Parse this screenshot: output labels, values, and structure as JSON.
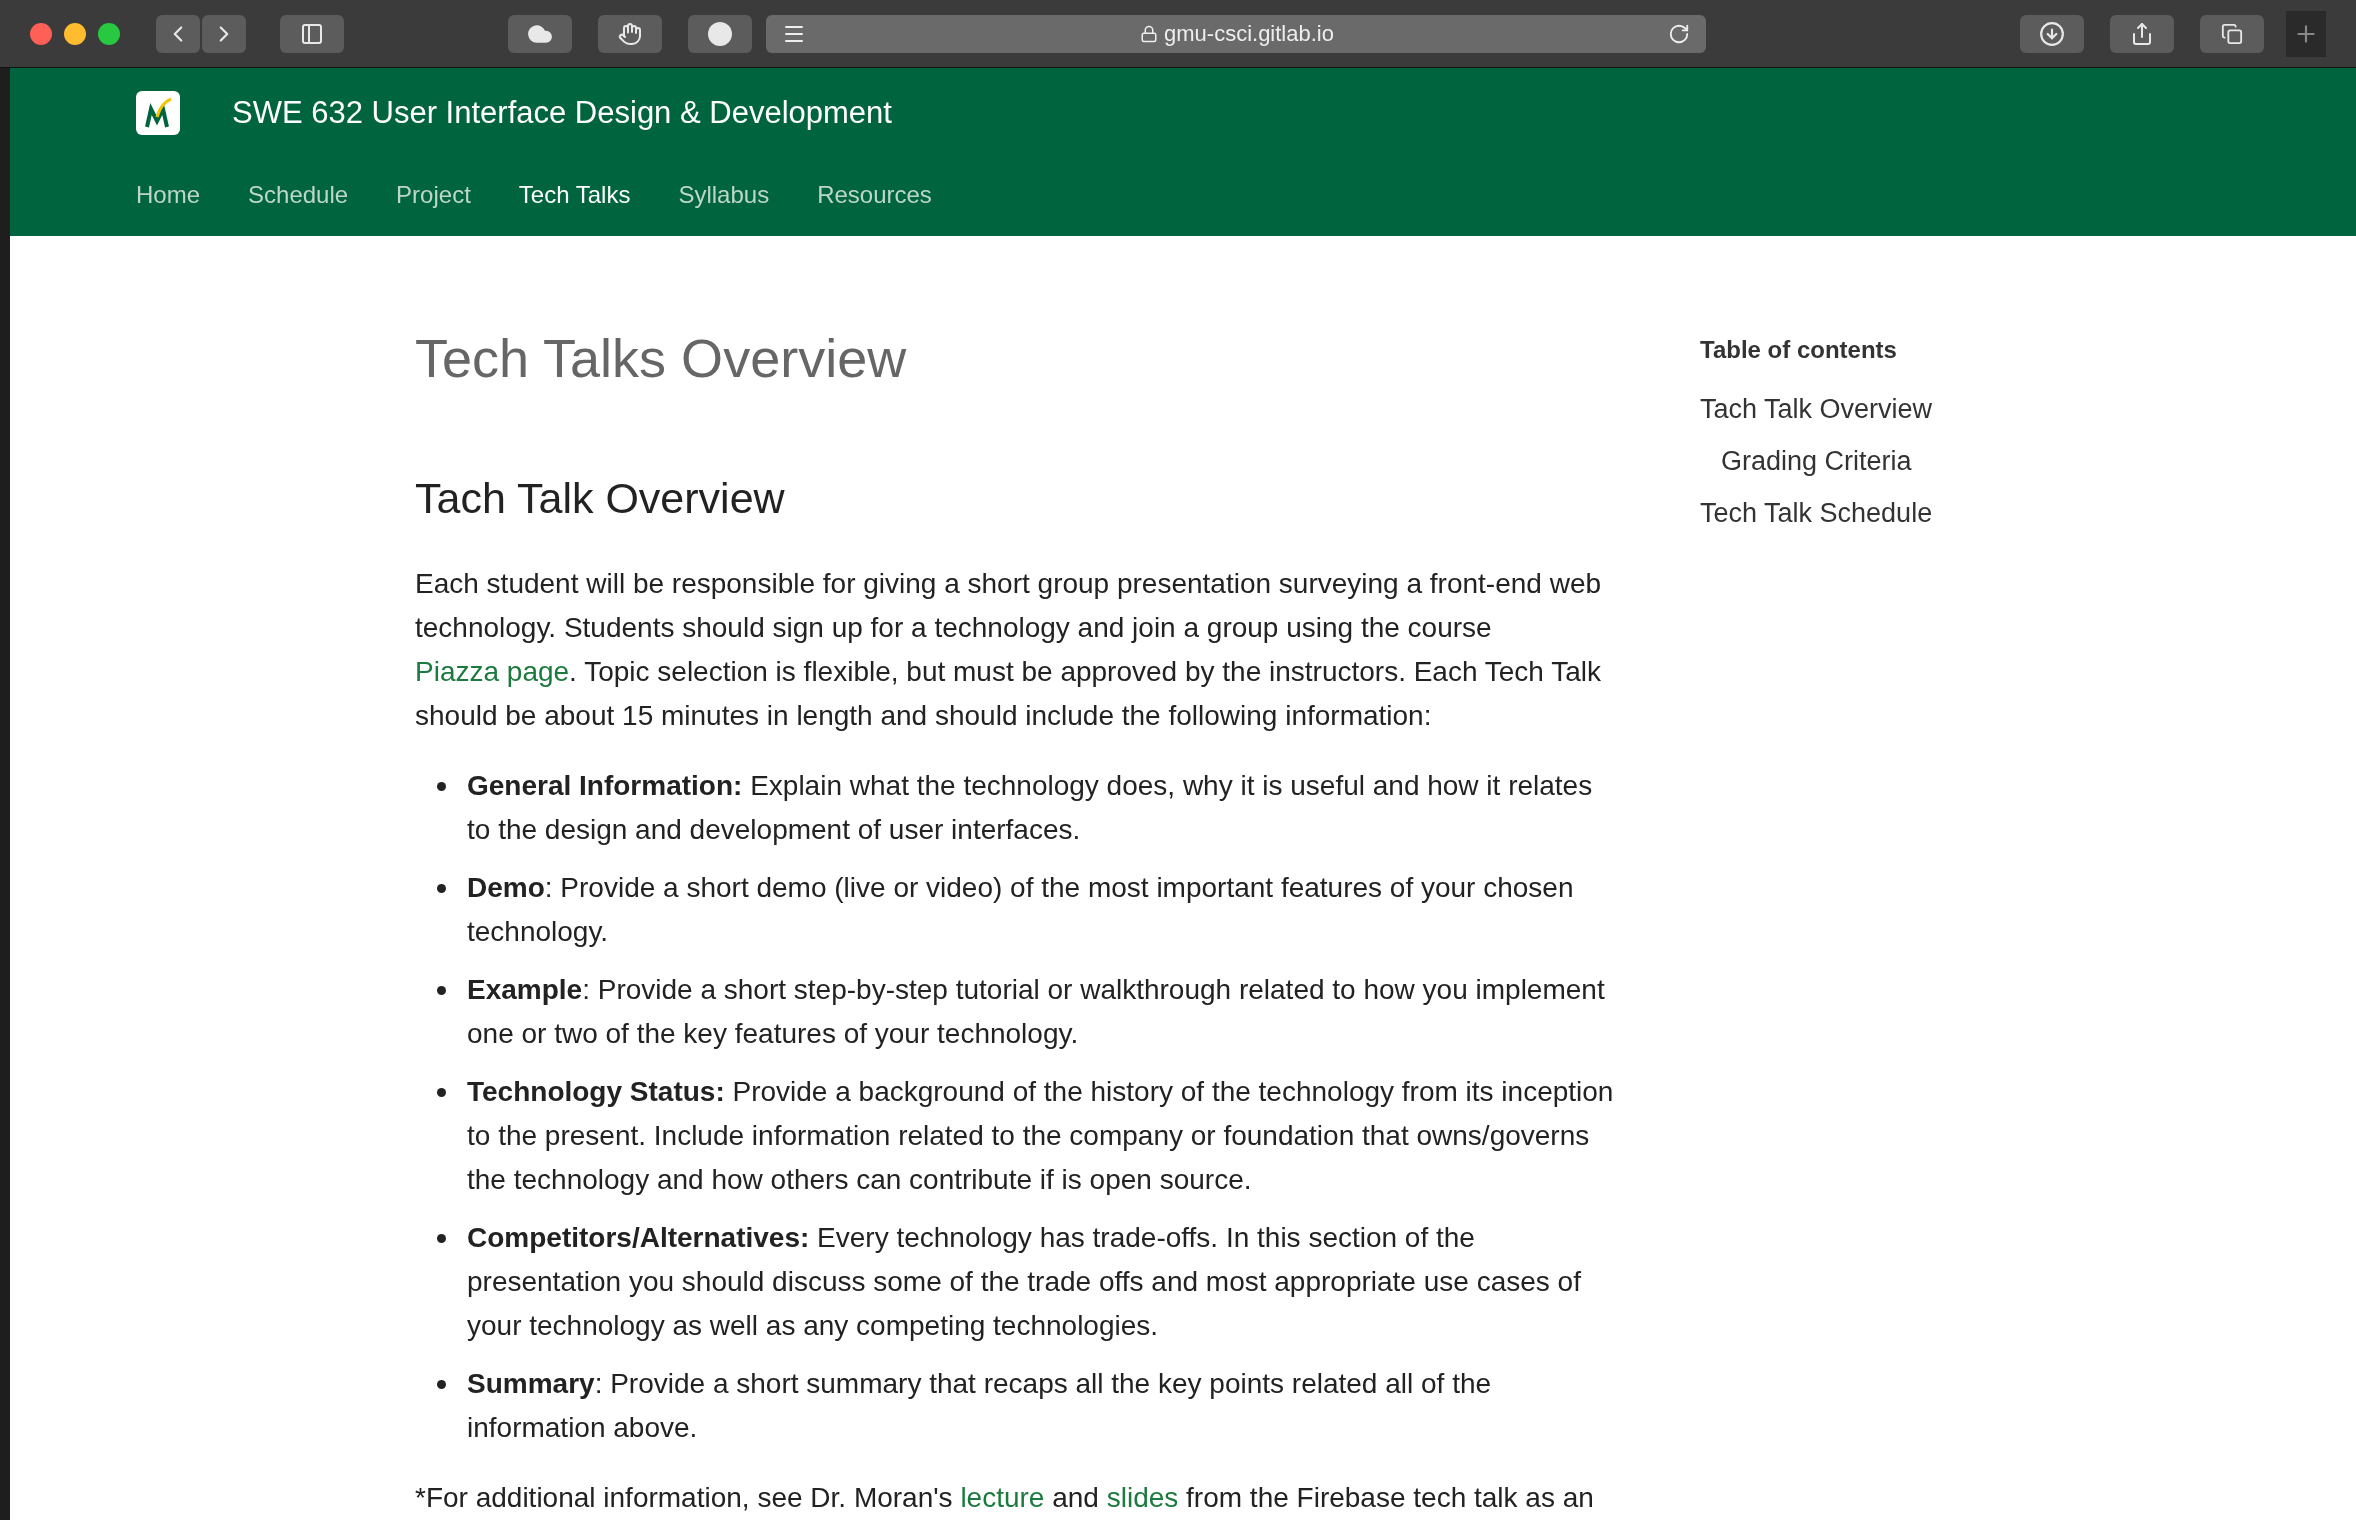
{
  "browser": {
    "url": "gmu-csci.gitlab.io"
  },
  "header": {
    "title": "SWE 632 User Interface Design & Development",
    "nav": [
      {
        "label": "Home",
        "selected": false
      },
      {
        "label": "Schedule",
        "selected": false
      },
      {
        "label": "Project",
        "selected": false
      },
      {
        "label": "Tech Talks",
        "selected": true
      },
      {
        "label": "Syllabus",
        "selected": false
      },
      {
        "label": "Resources",
        "selected": false
      }
    ]
  },
  "main": {
    "title": "Tech Talks Overview",
    "heading": "Tach Talk Overview",
    "intro": [
      {
        "kind": "text",
        "text": "Each student will be responsible for giving a short group presentation surveying a front-end web technology. Students should sign up for a technology and join a group using the course "
      },
      {
        "kind": "link",
        "text": "Piazza page"
      },
      {
        "kind": "text",
        "text": ". Topic selection is flexible, but must be approved by the instructors. Each Tech Talk should be about 15 minutes in length and should include the following information:"
      }
    ],
    "items": [
      "**General Information:** Explain what the technology does, why it is useful and how it relates to the design and development of user interfaces.",
      "**Demo**: Provide a short demo (live or video) of the most important features of your chosen technology.",
      "**Example**: Provide a short step-by-step tutorial or walkthrough related to how you implement one or two of the key features of your technology.",
      "**Technology Status:** Provide a background of the history of the technology from its inception to the present. Include information related to the company or foundation that owns/governs the technology and how others can contribute if is open source.",
      "**Competitors/Alternatives:** Every technology has trade-offs. In this section of the presentation you should discuss some of the trade offs and most appropriate use cases of your technology as well as any competing technologies.",
      "**Summary**: Provide a short summary that recaps all the key points related all of the information above."
    ],
    "note": [
      {
        "kind": "text",
        "text": "*For additional information, see Dr. Moran's "
      },
      {
        "kind": "link",
        "text": "lecture"
      },
      {
        "kind": "text",
        "text": " and "
      },
      {
        "kind": "link",
        "text": "slides"
      },
      {
        "kind": "text",
        "text": " from the Firebase tech talk as an"
      }
    ]
  },
  "toc": {
    "heading": "Table of contents",
    "items": [
      {
        "label": "Tach Talk Overview",
        "children": [
          {
            "label": "Grading Criteria"
          }
        ]
      },
      {
        "label": "Tech Talk Schedule"
      }
    ]
  }
}
